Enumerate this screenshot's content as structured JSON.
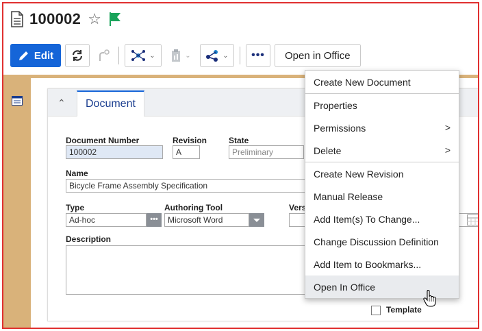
{
  "header": {
    "title": "100002",
    "star": "☆",
    "doc_icon": "document-icon",
    "flag_icon": "flag-icon",
    "flag_color": "#1aa35a"
  },
  "toolbar": {
    "edit_label": "Edit",
    "more_label": "•••",
    "open_office_label": "Open in Office",
    "accent": "#1565d8"
  },
  "panel": {
    "tab_label": "Document",
    "fields": {
      "doc_number_label": "Document Number",
      "doc_number_value": "100002",
      "revision_label": "Revision",
      "revision_value": "A",
      "state_label": "State",
      "state_value": "Preliminary",
      "name_label": "Name",
      "name_value": "Bicycle Frame Assembly Specification",
      "type_label": "Type",
      "type_value": "Ad-hoc",
      "authoring_label": "Authoring Tool",
      "authoring_value": "Microsoft Word",
      "version_label": "Vers",
      "description_label": "Description",
      "template_label": "Template"
    }
  },
  "menu": {
    "items": [
      {
        "label": "Create New Document"
      },
      {
        "label": "Properties"
      },
      {
        "label": "Permissions",
        "submenu": ">"
      },
      {
        "label": "Delete",
        "submenu": ">"
      },
      {
        "label": "Create New Revision"
      },
      {
        "label": "Manual Release"
      },
      {
        "label": "Add Item(s) To Change..."
      },
      {
        "label": "Change Discussion Definition"
      },
      {
        "label": "Add Item to Bookmarks..."
      },
      {
        "label": "Open In Office"
      }
    ],
    "hovered": "Open In Office"
  }
}
